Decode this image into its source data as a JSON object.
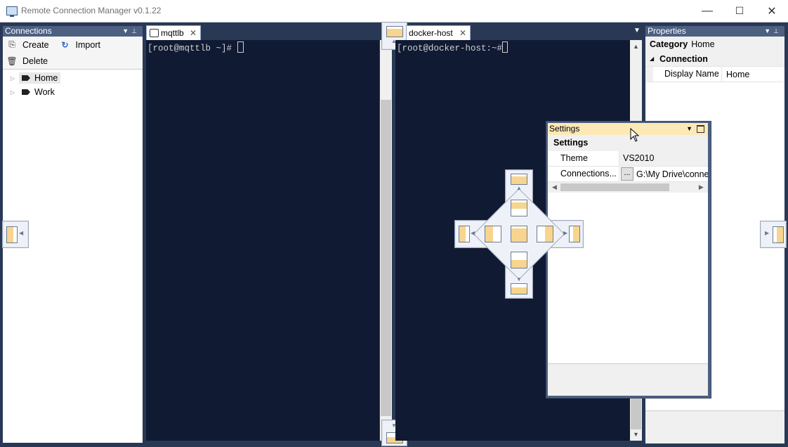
{
  "window": {
    "title": "Remote Connection Manager v0.1.22",
    "minimize_glyph": "—",
    "maximize_glyph": "☐",
    "close_glyph": "✕"
  },
  "connections": {
    "header": "Connections",
    "toolbar": {
      "create_label": "Create",
      "import_label": "Import",
      "delete_label": "Delete"
    },
    "tree": [
      {
        "label": "Home",
        "icon": "tag-icon",
        "selected": true
      },
      {
        "label": "Work",
        "icon": "tag-icon",
        "selected": false
      }
    ]
  },
  "tabs": {
    "left_tab": {
      "label": "mqttlb",
      "close": "✕"
    },
    "right_tab": {
      "label": "docker-host",
      "close": "✕"
    }
  },
  "terminals": {
    "left_prompt": "[root@mqttlb ~]# ",
    "right_prompt": "[root@docker-host:~#"
  },
  "properties": {
    "header": "Properties",
    "category_label": "Category",
    "category_value": "Home",
    "section": "Connection",
    "rows": [
      {
        "name": "Display Name",
        "value": "Home"
      }
    ]
  },
  "settings": {
    "title": "Settings",
    "section": "Settings",
    "rows": [
      {
        "name": "Theme",
        "value": "VS2010"
      },
      {
        "name": "Connections...",
        "button": "...",
        "value": "G:\\My Drive\\connec"
      }
    ]
  },
  "colors": {
    "background": "#293955",
    "panel_header": "#4d6082",
    "terminal_bg": "#101a33",
    "dock_fill": "#f7d58e",
    "floating_header": "#fde9b6"
  }
}
